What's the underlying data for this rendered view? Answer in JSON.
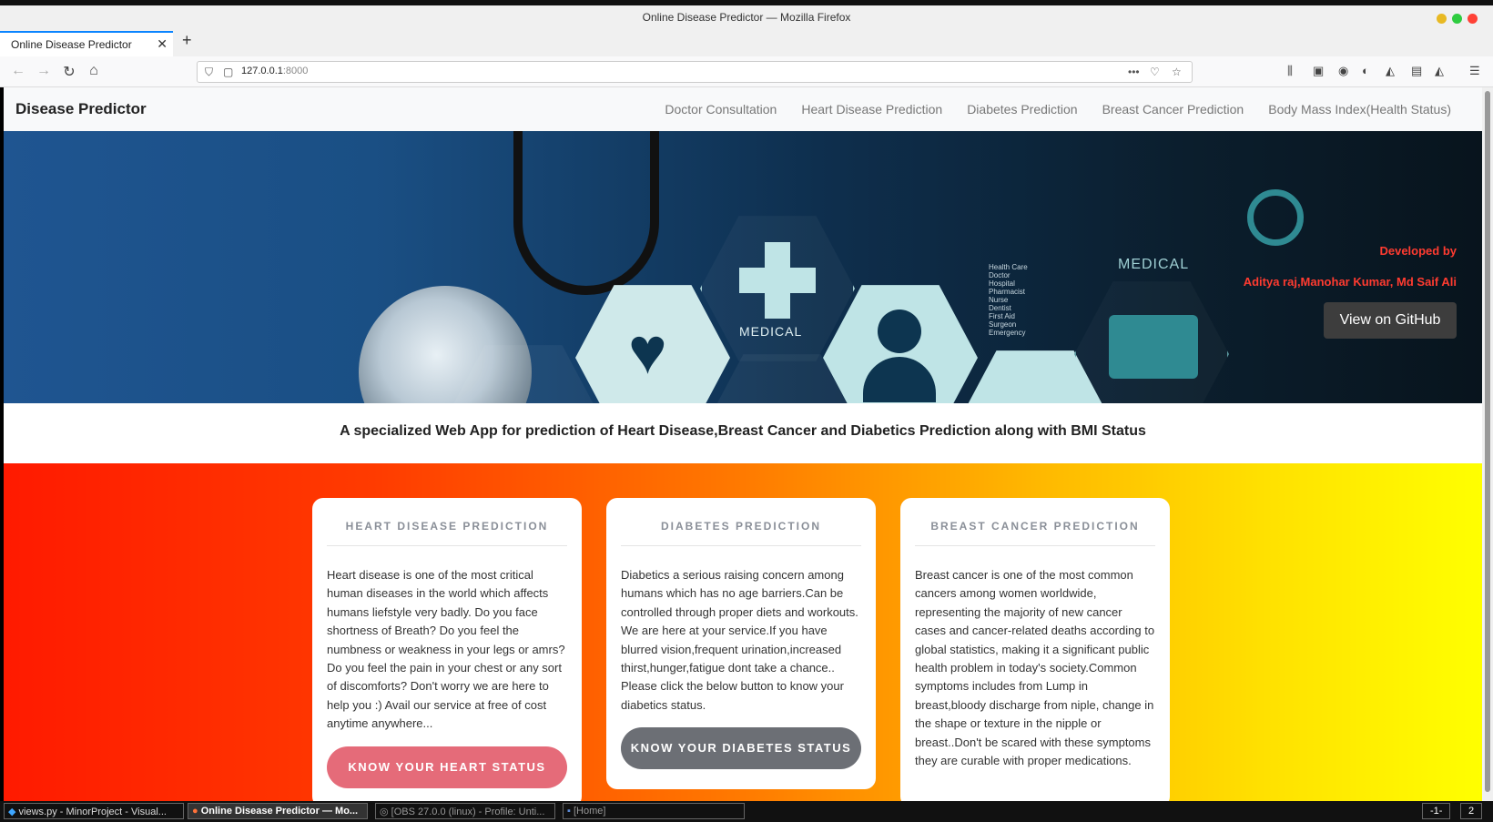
{
  "window": {
    "title": "Online Disease Predictor — Mozilla Firefox"
  },
  "browser": {
    "tab_title": "Online Disease Predictor",
    "url_host": "127.0.0.1",
    "url_port": ":8000"
  },
  "site": {
    "brand": "Disease Predictor",
    "nav_links": [
      "Doctor Consultation",
      "Heart Disease Prediction",
      "Diabetes Prediction",
      "Breast Cancer Prediction",
      "Body Mass Index(Health Status)"
    ]
  },
  "hero": {
    "developed_by": "Developed by",
    "authors": "Aditya raj,Manohar Kumar, Md Saif Ali",
    "github_button": "View on GitHub",
    "medical_label_1": "MEDICAL",
    "medical_label_2": "MEDICAL",
    "list_items": [
      "Health Care",
      "Doctor",
      "Hospital",
      "Pharmacist",
      "Nurse",
      "Dentist",
      "First Aid",
      "Surgeon",
      "Emergency"
    ]
  },
  "tagline": "A specialized Web App for prediction of Heart Disease,Breast Cancer and Diabetics Prediction along with BMI Status",
  "cards": [
    {
      "title": "HEART DISEASE PREDICTION",
      "body": "Heart disease is one of the most critical human diseases in the world which affects humans liefstyle very badly. Do you face shortness of Breath? Do you feel the numbness or weakness in your legs or amrs? Do you feel the pain in your chest or any sort of discomforts? Don't worry we are here to help you :) Avail our service at free of cost anytime anywhere...",
      "button": "KNOW YOUR HEART STATUS"
    },
    {
      "title": "DIABETES PREDICTION",
      "body": "Diabetics a serious raising concern among humans which has no age barriers.Can be controlled through proper diets and workouts. We are here at your service.If you have blurred vision,frequent urination,increased thirst,hunger,fatigue dont take a chance.. Please click the below button to know your diabetics status.",
      "button": "KNOW YOUR DIABETES STATUS"
    },
    {
      "title": "BREAST CANCER PREDICTION",
      "body": "Breast cancer is one of the most common cancers among women worldwide, representing the majority of new cancer cases and cancer-related deaths according to global statistics, making it a significant public health problem in today's society.Common symptoms includes from Lump in breast,bloody discharge from niple, change in the shape or texture in the nipple or breast..Don't be scared with these symptoms they are curable with proper medications."
    }
  ],
  "taskbar": {
    "items": [
      "views.py - MinorProject - Visual...",
      "Online Disease Predictor — Mo...",
      "[OBS 27.0.0 (linux) - Profile: Unti...",
      "[Home]"
    ],
    "workspace_1": "-1-",
    "workspace_2": "2"
  }
}
